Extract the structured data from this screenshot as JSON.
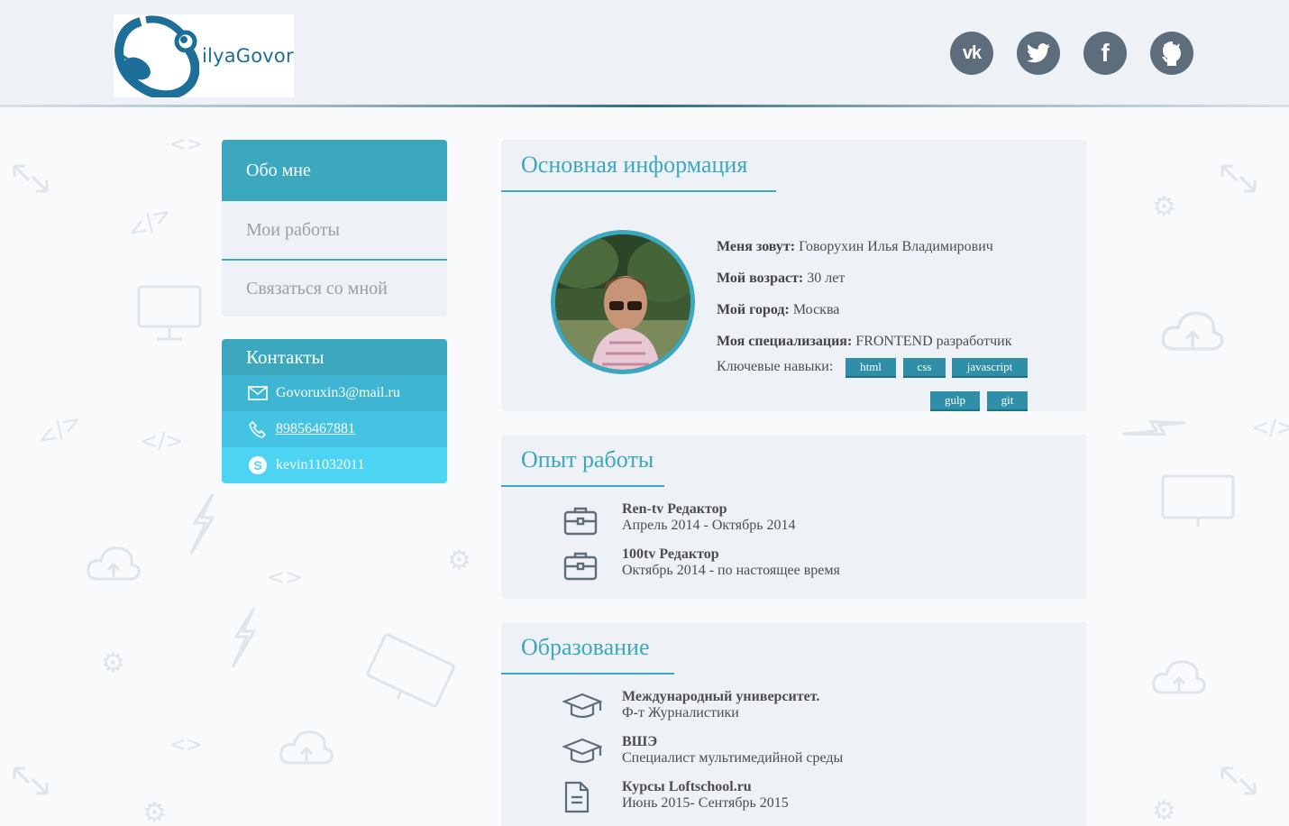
{
  "header": {
    "logo_text": "ilyaGovor",
    "social": [
      {
        "name": "vk",
        "icon": "vk-icon"
      },
      {
        "name": "twitter",
        "icon": "twitter-icon"
      },
      {
        "name": "facebook",
        "icon": "facebook-icon"
      },
      {
        "name": "github",
        "icon": "github-icon"
      }
    ]
  },
  "menu": {
    "items": [
      {
        "label": "Обо мне",
        "active": true
      },
      {
        "label": "Мои работы",
        "active": false
      },
      {
        "label": "Связаться со мной",
        "active": false
      }
    ]
  },
  "contacts": {
    "title": "Контакты",
    "email": "Govoruxin3@mail.ru",
    "phone": "89856467881",
    "skype": "kevin11032011"
  },
  "basic_info": {
    "title": "Основная информация",
    "name_label": "Меня зовут:",
    "name_value": "Говорухин Илья Владимирович",
    "age_label": "Мой возраст:",
    "age_value": "30 лет",
    "city_label": "Мой город:",
    "city_value": "Москва",
    "spec_label": "Моя специализация:",
    "spec_value": "FRONTEND разработчик",
    "skills_label": "Ключевые навыки:",
    "skills": [
      "html",
      "css",
      "javascript",
      "gulp",
      "git"
    ]
  },
  "experience": {
    "title": "Опыт работы",
    "items": [
      {
        "title": "Ren-tv Редактор",
        "period": "Апрель 2014 - Октябрь 2014"
      },
      {
        "title": "100tv Редактор",
        "period": "Октябрь 2014 - по настоящее время"
      }
    ]
  },
  "education": {
    "title": "Образование",
    "items": [
      {
        "title": "Международный университет.",
        "detail": "Ф-т Журналистики"
      },
      {
        "title": "ВШЭ",
        "detail": "Специалист мультимедийной среды"
      },
      {
        "title": "Курсы Loftschool.ru",
        "detail": "Июнь 2015- Сентябрь 2015"
      }
    ]
  },
  "colors": {
    "accent": "#3ca8c0",
    "social_bg": "#5d6d7b",
    "tag_bg": "#2f8fa8",
    "card_bg": "#eef1f5"
  }
}
